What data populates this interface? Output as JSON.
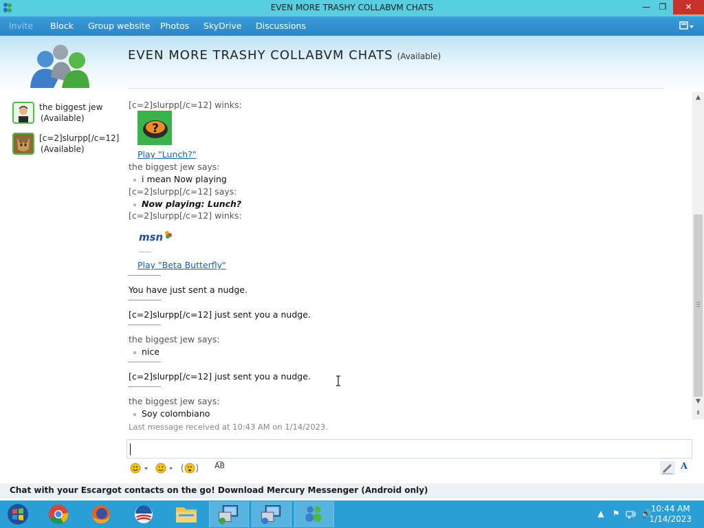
{
  "window": {
    "title": "EVEN MORE TRASHY COLLABVM CHATS",
    "controls": {
      "minimize": "—",
      "maximize": "❐",
      "close": "✕"
    }
  },
  "menu": {
    "items": [
      "Invite",
      "Block",
      "Group website",
      "Photos",
      "SkyDrive",
      "Discussions"
    ],
    "disabled": [
      "Invite"
    ]
  },
  "header": {
    "title": "EVEN MORE TRASHY COLLABVM CHATS",
    "status": "(Available)"
  },
  "participants": [
    {
      "name": "the biggest jew",
      "status": "(Available)"
    },
    {
      "name": "[c=2]slurpp[/c=12]",
      "status": "(Available)"
    }
  ],
  "chat": {
    "messages": [
      {
        "kind": "says",
        "text": "[c=2]slurpp[/c=12] winks:"
      },
      {
        "kind": "wink-image",
        "icon": "lunch-wink-icon"
      },
      {
        "kind": "link",
        "text": "Play \"Lunch?\""
      },
      {
        "kind": "says",
        "text": "the biggest jew says:"
      },
      {
        "kind": "msg",
        "text": "i mean Now playing"
      },
      {
        "kind": "says",
        "text": "[c=2]slurpp[/c=12] says:"
      },
      {
        "kind": "msg-italic",
        "text": "Now playing: Lunch?"
      },
      {
        "kind": "says",
        "text": "[c=2]slurpp[/c=12] winks:"
      },
      {
        "kind": "wink-image",
        "icon": "msn-logo-icon"
      },
      {
        "kind": "link",
        "text": "Play \"Beta Butterfly\""
      },
      {
        "kind": "notice",
        "text": "You have just sent a nudge."
      },
      {
        "kind": "notice",
        "text": "[c=2]slurpp[/c=12] just sent you a nudge."
      },
      {
        "kind": "says",
        "text": "the biggest jew says:"
      },
      {
        "kind": "msg",
        "text": "nice"
      },
      {
        "kind": "notice",
        "text": "[c=2]slurpp[/c=12] just sent you a nudge."
      },
      {
        "kind": "says",
        "text": "the biggest jew says:"
      },
      {
        "kind": "msg",
        "text": "Soy colombiano"
      }
    ],
    "last_received": "Last message received at 10:43 AM on 1/14/2023."
  },
  "input": {
    "value": ""
  },
  "toolbar": {
    "icons": [
      "emoticon-icon",
      "wink-icon",
      "nudge-icon",
      "font-style-icon",
      "handwriting-icon",
      "font-icon"
    ],
    "font_letter": "A",
    "font_style": "A͡B"
  },
  "ad": {
    "text": "Chat with your Escargot contacts on the go! Download Mercury Messenger (Android only)"
  },
  "taskbar": {
    "apps": [
      "start-icon",
      "chrome-icon",
      "firefox-icon",
      "obama-logo-icon",
      "file-explorer-icon",
      "network-app-icon",
      "network-app-icon-2",
      "messenger-icon"
    ],
    "clock": {
      "time": "10:44 AM",
      "date": "1/14/2023"
    }
  },
  "colors": {
    "titlebar": "#58cfe0",
    "menubar": "#2b86c8",
    "taskbar": "#2a9fd6",
    "link": "#1a5fa8",
    "close": "#c7312a"
  }
}
